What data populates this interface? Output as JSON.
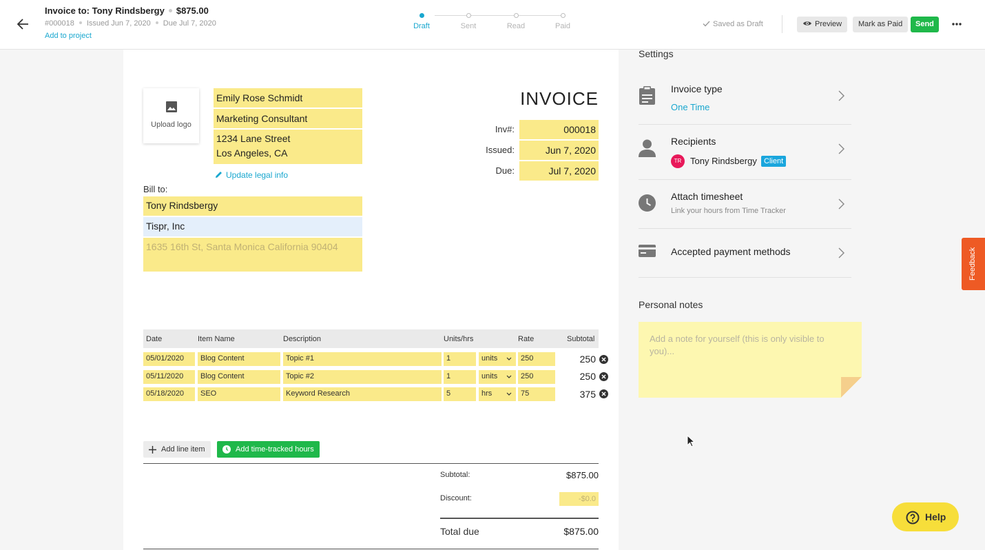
{
  "header": {
    "title": "Invoice to: Tony Rindsbergy",
    "amount": "$875.00",
    "number": "#000018",
    "issued": "Issued Jun 7, 2020",
    "due": "Due Jul 7, 2020",
    "add_project": "Add to project",
    "steps": [
      "Draft",
      "Sent",
      "Read",
      "Paid"
    ],
    "active_step": "Draft",
    "saved_status": "Saved as Draft",
    "preview_label": "Preview",
    "mark_paid_label": "Mark as Paid",
    "send_label": "Send"
  },
  "invoice": {
    "upload_logo": "Upload logo",
    "sender": {
      "name": "Emily Rose Schmidt",
      "title": "Marketing Consultant",
      "address_line1": "1234 Lane Street",
      "address_line2": "Los Angeles, CA"
    },
    "update_legal": "Update legal info",
    "bill_to_label": "Bill to:",
    "bill_to": {
      "name": "Tony Rindsbergy",
      "company": "Tispr, Inc",
      "address_placeholder": "1635 16th St, Santa Monica California 90404"
    },
    "heading": "INVOICE",
    "inv_label": "Inv#:",
    "inv_number": "000018",
    "issued_label": "Issued:",
    "issued_date": "Jun 7, 2020",
    "due_label": "Due:",
    "due_date": "Jul 7, 2020",
    "columns": [
      "Date",
      "Item Name",
      "Description",
      "Units/hrs",
      "Rate",
      "Subtotal"
    ],
    "rows": [
      {
        "date": "05/01/2020",
        "item": "Blog Content",
        "description": "Topic #1",
        "qty": "1",
        "unit": "units",
        "rate": "250",
        "subtotal": "250"
      },
      {
        "date": "05/11/2020",
        "item": "Blog Content",
        "description": "Topic #2",
        "qty": "1",
        "unit": "units",
        "rate": "250",
        "subtotal": "250"
      },
      {
        "date": "05/18/2020",
        "item": "SEO",
        "description": "Keyword Research",
        "qty": "5",
        "unit": "hrs",
        "rate": "75",
        "subtotal": "375"
      }
    ],
    "add_line_item": "Add line item",
    "add_time_tracked": "Add time-tracked hours",
    "subtotal_label": "Subtotal:",
    "subtotal_value": "$875.00",
    "discount_label": "Discount:",
    "discount_placeholder": "-$0.0",
    "total_label": "Total due",
    "total_value": "$875.00"
  },
  "settings": {
    "title": "Settings",
    "invoice_type_label": "Invoice type",
    "invoice_type_value": "One Time",
    "recipients_label": "Recipients",
    "recipient_initials": "TR",
    "recipient_name": "Tony Rindsbergy",
    "recipient_badge": "Client",
    "timesheet_label": "Attach timesheet",
    "timesheet_sub": "Link your hours from Time Tracker",
    "payment_label": "Accepted payment methods",
    "notes_title": "Personal notes",
    "notes_placeholder": "Add a note for yourself (this is only visible to you)..."
  },
  "feedback_label": "Feedback",
  "help_label": "Help",
  "colors": {
    "accent": "#19a7cf",
    "send_green": "#1fb84a",
    "field_yellow": "#faea8a",
    "feedback_orange": "#ee5a24",
    "help_yellow": "#f7de3a",
    "avatar_pink": "#e8195a",
    "badge_blue": "#1aa6dd"
  }
}
